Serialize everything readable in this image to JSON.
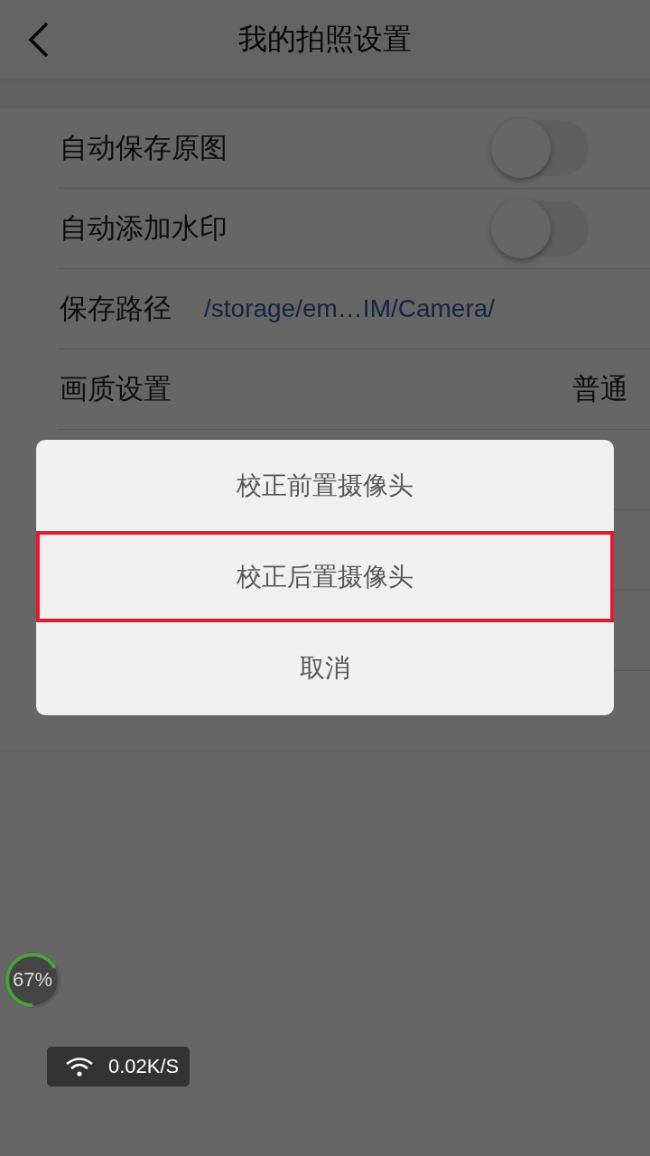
{
  "header": {
    "title": "我的拍照设置"
  },
  "settings": [
    {
      "kind": "toggle",
      "label": "自动保存原图",
      "on": false
    },
    {
      "kind": "toggle",
      "label": "自动添加水印",
      "on": false
    },
    {
      "kind": "path",
      "label": "保存路径",
      "value": "/storage/em…IM/Camera/"
    },
    {
      "kind": "value",
      "label": "画质设置",
      "value": "普通"
    }
  ],
  "action_sheet": {
    "items": [
      {
        "label": "校正前置摄像头",
        "highlighted": false
      },
      {
        "label": "校正后置摄像头",
        "highlighted": true
      },
      {
        "label": "取消",
        "highlighted": false
      }
    ]
  },
  "memory_badge": {
    "text": "67%",
    "level": 0.67
  },
  "network_badge": {
    "speed": "0.02K/S"
  }
}
